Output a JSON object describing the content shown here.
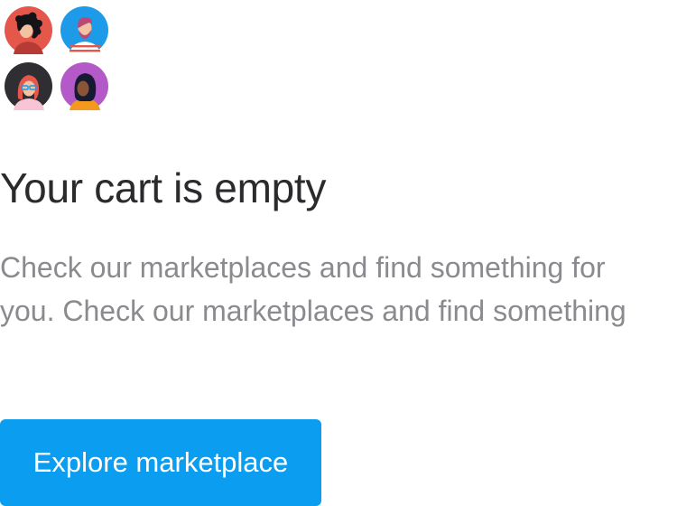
{
  "avatars": [
    {
      "icon": "avatar-curly-hair-icon",
      "bg": "#e5574b"
    },
    {
      "icon": "avatar-bearded-man-icon",
      "bg": "#1e9be8"
    },
    {
      "icon": "avatar-glasses-woman-icon",
      "bg": "#2e2e33"
    },
    {
      "icon": "avatar-headscarf-woman-icon",
      "bg": "#b45ac8"
    }
  ],
  "empty_state": {
    "title": "Your cart is empty",
    "description": "Check our marketplaces and find something for you. Check our marketplaces and find something"
  },
  "cta": {
    "label": "Explore marketplace",
    "color": "#0a9df0"
  }
}
